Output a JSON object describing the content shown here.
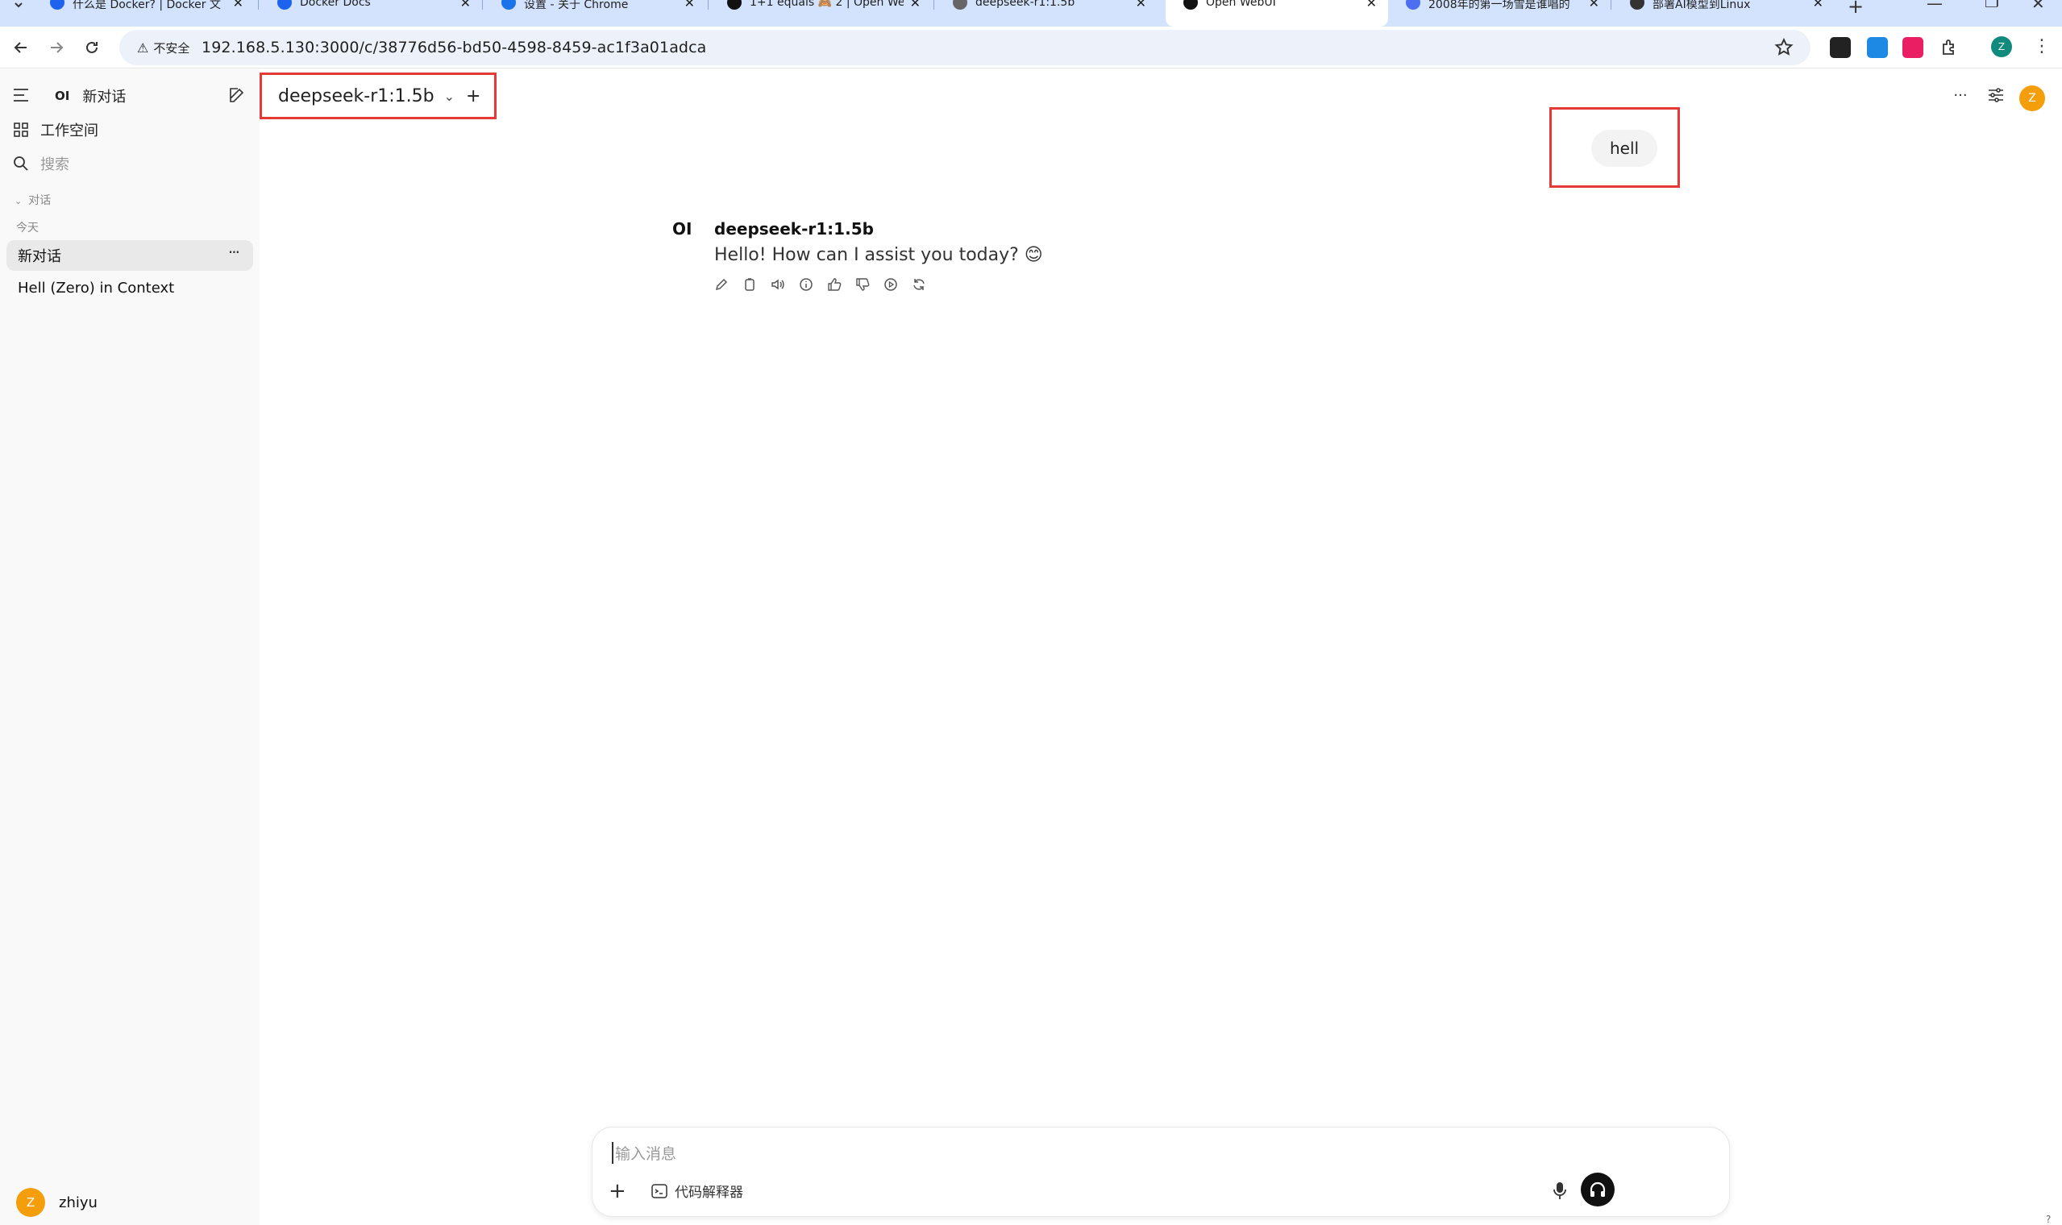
{
  "browser": {
    "tabs": [
      {
        "title": "什么是 Docker? | Docker 文",
        "icon_color": "#1d63ed",
        "active": false
      },
      {
        "title": "Docker Docs",
        "icon_color": "#1d63ed",
        "active": false
      },
      {
        "title": "设置 - 关于 Chrome",
        "icon_color": "#1a73e8",
        "active": false
      },
      {
        "title": "1+1 equals 🙈 2 | Open We",
        "icon_color": "#111111",
        "active": false
      },
      {
        "title": "deepseek-r1:1.5b",
        "icon_color": "#666666",
        "active": false
      },
      {
        "title": "Open WebUI",
        "icon_color": "#111111",
        "active": true
      },
      {
        "title": "2008年的第一场雪是谁唱的",
        "icon_color": "#4e6ef2",
        "active": false
      },
      {
        "title": "部署AI模型到Linux",
        "icon_color": "#333333",
        "active": false
      }
    ],
    "tab_close": "✕",
    "new_tab": "+",
    "security_label": "不安全",
    "url": "192.168.5.130:3000/c/38776d56-bd50-4598-8459-ac1f3a01adca",
    "profile_initial": "Z"
  },
  "sidebar": {
    "logo": "OI",
    "new_chat": "新对话",
    "workspace": "工作空间",
    "search_placeholder": "搜索",
    "section_chats": "对话",
    "section_today": "今天",
    "items": [
      {
        "label": "新对话",
        "active": true
      },
      {
        "label": "Hell (Zero) in Context",
        "active": false
      }
    ],
    "more": "···",
    "user": {
      "initial": "Z",
      "name": "zhiyu"
    }
  },
  "header": {
    "model": "deepseek-r1:1.5b",
    "add": "+",
    "more": "···",
    "avatar_initial": "Z"
  },
  "chat": {
    "user_message": "hell",
    "assistant": {
      "logo": "OI",
      "name": "deepseek-r1:1.5b",
      "text": "Hello! How can I assist you today? 😊"
    }
  },
  "composer": {
    "placeholder": "输入消息",
    "plus": "+",
    "tool_label": "代码解释器"
  },
  "help": "?"
}
